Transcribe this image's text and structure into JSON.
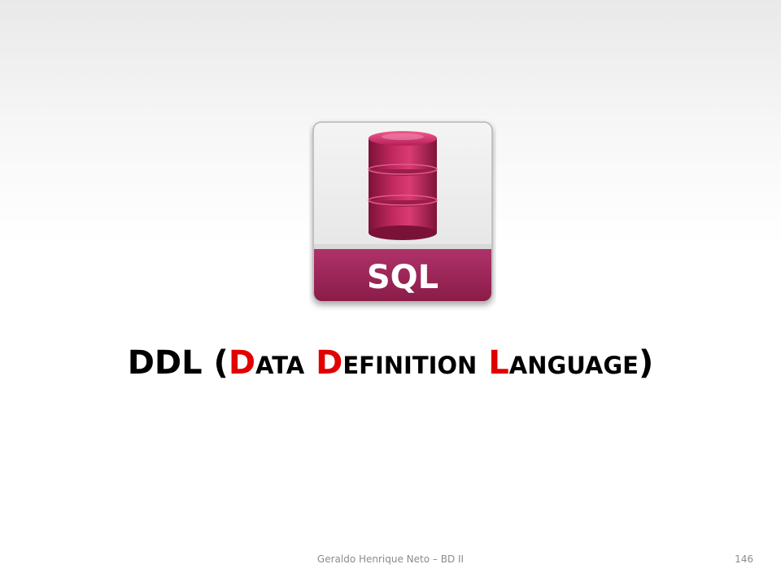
{
  "slide": {
    "icon": {
      "name": "sql-database-file-icon",
      "label": "SQL",
      "accent_color": "#a8265a",
      "band_color": "#9a2352"
    },
    "title": {
      "prefix": "DDL (",
      "word1_initial": "D",
      "word1_rest": "ATA",
      "word2_initial": "D",
      "word2_rest": "EFINITION",
      "word3_initial": "L",
      "word3_rest": "ANGUAGE",
      "suffix": ")",
      "highlight_color": "#e10000"
    },
    "footer": {
      "author": "Geraldo Henrique Neto – BD II",
      "page_number": "146"
    }
  }
}
